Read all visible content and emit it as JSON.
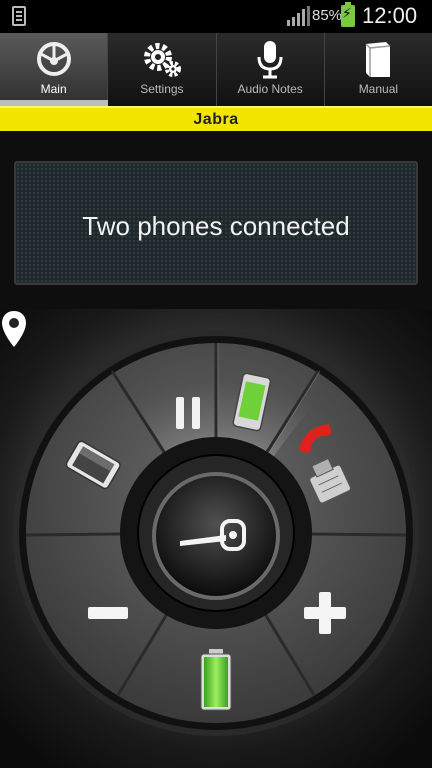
{
  "status_bar": {
    "battery_percent": "85%",
    "time": "12:00",
    "icons": [
      "storage-icon",
      "signal-icon",
      "battery-charging-icon"
    ]
  },
  "tabs": [
    {
      "label": "Main",
      "icon": "dashboard-icon",
      "active": true
    },
    {
      "label": "Settings",
      "icon": "gears-icon",
      "active": false
    },
    {
      "label": "Audio Notes",
      "icon": "microphone-icon",
      "active": false
    },
    {
      "label": "Manual",
      "icon": "book-icon",
      "active": false
    }
  ],
  "brand": {
    "name": "Jabra",
    "color": "#f3e500"
  },
  "status": {
    "message": "Two phones connected"
  },
  "controls": {
    "icons": [
      "pause-icon",
      "phone-green-icon",
      "end-call-icon",
      "car-charger-icon",
      "phone-secondary-icon",
      "volume-down-icon",
      "volume-up-icon",
      "headset-battery-icon",
      "headset-icon",
      "location-icon"
    ],
    "battery_level": 1.0,
    "accent_green": "#6fd13a",
    "accent_red": "#e0201c"
  }
}
